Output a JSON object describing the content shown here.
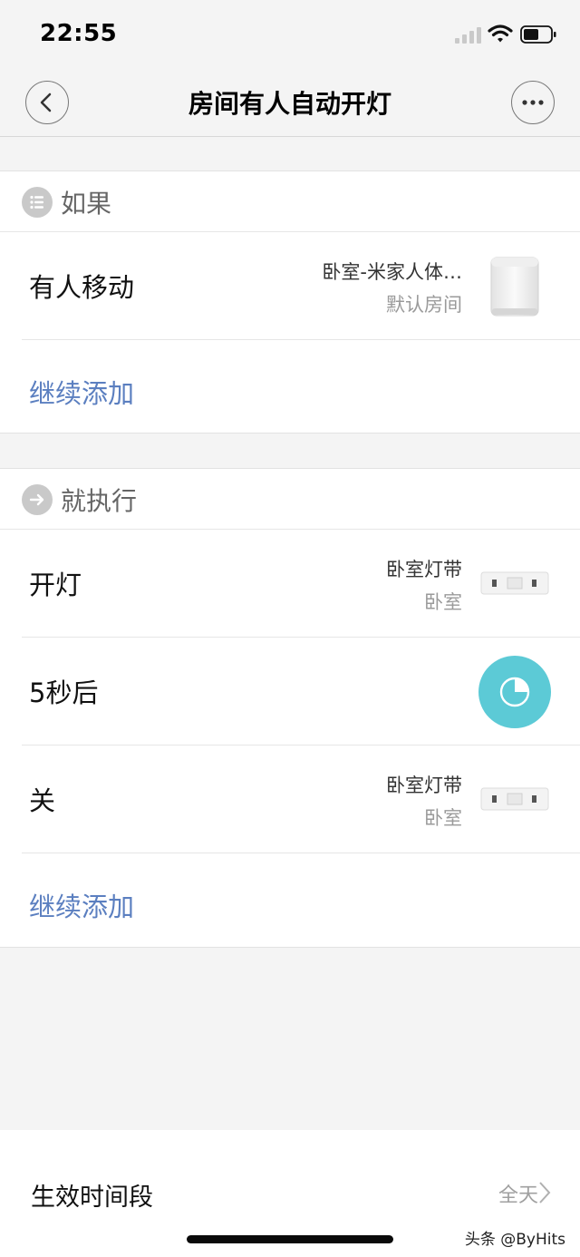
{
  "status_bar": {
    "time": "22:55"
  },
  "nav": {
    "title": "房间有人自动开灯"
  },
  "if_section": {
    "title": "如果",
    "rows": [
      {
        "label": "有人移动",
        "device": "卧室-米家人体…",
        "room": "默认房间"
      }
    ],
    "add_label": "继续添加"
  },
  "then_section": {
    "title": "就执行",
    "rows": [
      {
        "label": "开灯",
        "device": "卧室灯带",
        "room": "卧室"
      },
      {
        "label": "5秒后"
      },
      {
        "label": "关",
        "device": "卧室灯带",
        "room": "卧室"
      }
    ],
    "add_label": "继续添加"
  },
  "schedule": {
    "label": "生效时间段",
    "value": "全天"
  },
  "watermark": "头条 @ByHits",
  "colors": {
    "accent_link": "#5b7fc0",
    "timer": "#5ccad6"
  },
  "icons": [
    "back-icon",
    "more-icon",
    "list-icon",
    "arrow-right-icon",
    "clock-icon",
    "chevron-right-icon"
  ]
}
